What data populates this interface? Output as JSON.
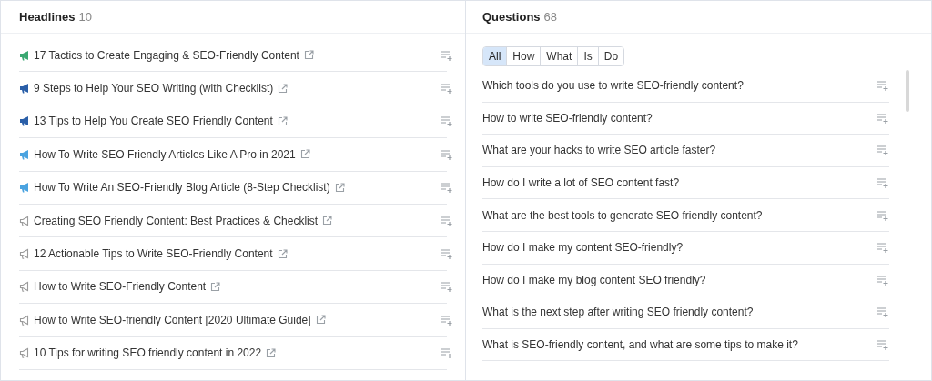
{
  "headlines": {
    "title": "Headlines",
    "count": "10",
    "items": [
      {
        "text": "17 Tactics to Create Engaging & SEO-Friendly Content",
        "kind": "filled",
        "color": "#3aa872"
      },
      {
        "text": "9 Steps to Help Your SEO Writing (with Checklist)",
        "kind": "filled",
        "color": "#2a5fa8"
      },
      {
        "text": "13 Tips to Help You Create SEO Friendly Content",
        "kind": "filled",
        "color": "#2a5fa8"
      },
      {
        "text": "How To Write SEO Friendly Articles Like A Pro in 2021",
        "kind": "filled",
        "color": "#4aa3e0"
      },
      {
        "text": "How To Write An SEO-Friendly Blog Article (8-Step Checklist)",
        "kind": "filled",
        "color": "#4aa3e0"
      },
      {
        "text": "Creating SEO Friendly Content: Best Practices & Checklist",
        "kind": "outline",
        "color": "#9a9a9a"
      },
      {
        "text": "12 Actionable Tips to Write SEO-Friendly Content",
        "kind": "outline",
        "color": "#9a9a9a"
      },
      {
        "text": "How to Write SEO-Friendly Content",
        "kind": "outline",
        "color": "#9a9a9a"
      },
      {
        "text": "How to Write SEO-friendly Content [2020 Ultimate Guide]",
        "kind": "outline",
        "color": "#9a9a9a"
      },
      {
        "text": "10 Tips for writing SEO friendly content in 2022",
        "kind": "outline",
        "color": "#9a9a9a"
      }
    ]
  },
  "questions": {
    "title": "Questions",
    "count": "68",
    "filters": [
      {
        "label": "All",
        "selected": true
      },
      {
        "label": "How",
        "selected": false
      },
      {
        "label": "What",
        "selected": false
      },
      {
        "label": "Is",
        "selected": false
      },
      {
        "label": "Do",
        "selected": false
      }
    ],
    "items": [
      "Which tools do you use to write SEO-friendly content?",
      "How to write SEO-friendly content?",
      "What are your hacks to write SEO article faster?",
      "How do I write a lot of SEO content fast?",
      "What are the best tools to generate SEO friendly content?",
      "How do I make my content SEO-friendly?",
      "How do I make my blog content SEO friendly?",
      "What is the next step after writing SEO friendly content?",
      "What is SEO-friendly content, and what are some tips to make it?"
    ]
  }
}
